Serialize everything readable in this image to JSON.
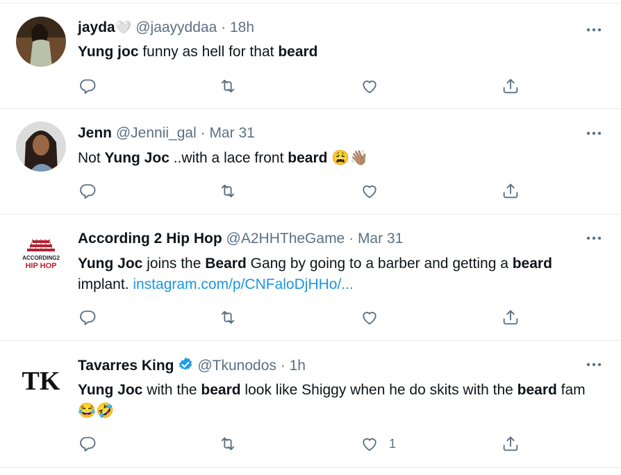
{
  "tweets": [
    {
      "name": "jayda",
      "name_suffix": "🤍",
      "handle": "@jaayyddaa",
      "separator": "·",
      "time": "18h",
      "body": [
        {
          "b": "Yung joc"
        },
        {
          "t": " funny as hell for that "
        },
        {
          "b": "beard"
        }
      ],
      "like_count": ""
    },
    {
      "name": "Jenn",
      "handle": "@Jennii_gal",
      "separator": "·",
      "time": "Mar 31",
      "body": [
        {
          "t": "Not "
        },
        {
          "b": "Yung Joc"
        },
        {
          "t": " ..with a lace front "
        },
        {
          "b": "beard"
        },
        {
          "t": " 😩👋🏽"
        }
      ],
      "like_count": ""
    },
    {
      "name": "According 2 Hip Hop",
      "handle": "@A2HHTheGame",
      "separator": "·",
      "time": "Mar 31",
      "avatar_text_top": "ACCORDING2",
      "avatar_text_bottom": "HIP HOP",
      "body": [
        {
          "b": "Yung Joc"
        },
        {
          "t": " joins the "
        },
        {
          "b": "Beard"
        },
        {
          "t": " Gang by going to a barber and getting a "
        },
        {
          "b": "beard"
        },
        {
          "t": " implant. "
        },
        {
          "l": "instagram.com/p/CNFaloDjHHo/..."
        }
      ],
      "like_count": ""
    },
    {
      "name": "Tavarres King",
      "verified": true,
      "handle": "@Tkunodos",
      "separator": "·",
      "time": "1h",
      "avatar_text": "TK",
      "body": [
        {
          "b": "Yung Joc"
        },
        {
          "t": " with the "
        },
        {
          "b": "beard"
        },
        {
          "t": " look like Shiggy when he do skits with the "
        },
        {
          "b": "beard"
        },
        {
          "t": " fam 😂🤣"
        }
      ],
      "like_count": "1"
    }
  ],
  "icons": {
    "reply": "reply-icon",
    "retweet": "retweet-icon",
    "like": "like-icon",
    "share": "share-icon",
    "more": "more-icon",
    "verified": "verified-badge-icon"
  },
  "colors": {
    "text": "#0f1419",
    "secondary": "#5b7083",
    "link": "#1b95e0",
    "verified": "#1d9bf0",
    "divider": "#e6ecf0"
  }
}
